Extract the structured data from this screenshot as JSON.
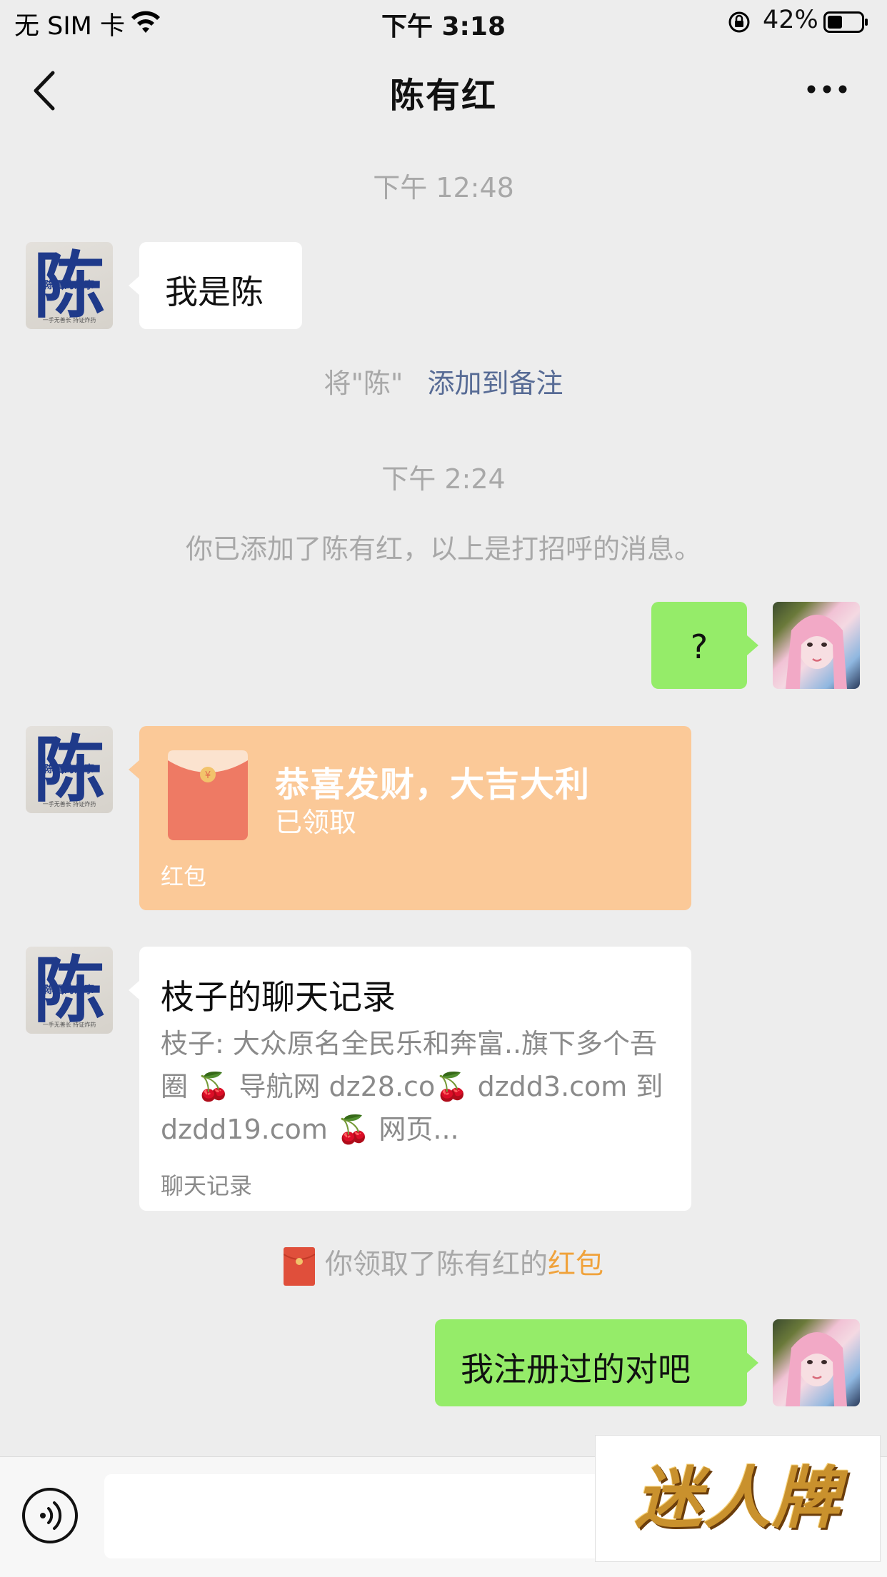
{
  "status_bar": {
    "carrier": "无 SIM 卡",
    "time": "下午 3:18",
    "battery": "42%"
  },
  "nav": {
    "title": "陈有红"
  },
  "avatar_chen": {
    "char": "陈",
    "caption": "陈雪的故事",
    "motto": "一手无善长 持证炸药"
  },
  "messages": {
    "ts1": "下午 12:48",
    "m1": "我是陈",
    "remark_prefix": "将\"陈\"",
    "remark_link": "添加到备注",
    "ts2": "下午 2:24",
    "added_notice": "你已添加了陈有红，以上是打招呼的消息。",
    "m2": "?",
    "red_packet": {
      "title": "恭喜发财，大吉大利",
      "status": "已领取",
      "label": "红包"
    },
    "record": {
      "title": "枝子的聊天记录",
      "body": "枝子: 大众原名全民乐和奔富..旗下多个吾圈 🍒 导航网 dz28.co🍒 dzdd3.com 到 dzdd19.com 🍒 网页...",
      "label": "聊天记录"
    },
    "received_prefix": "你领取了陈有红的",
    "received_link": "红包",
    "m3": "我注册过的对吧"
  },
  "watermark": "迷人牌",
  "colors": {
    "background": "#ededed",
    "green_bubble": "#95ec69",
    "red_packet": "#fbc998",
    "link": "#576b95",
    "highlight": "#f0a23b"
  }
}
